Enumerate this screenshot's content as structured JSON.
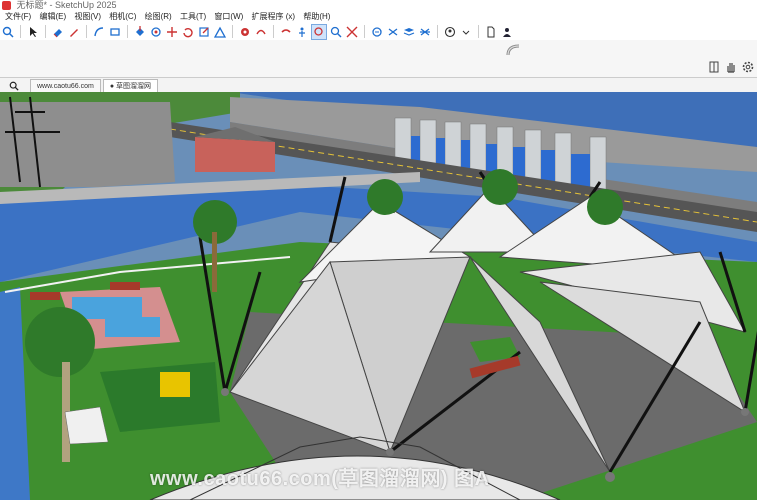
{
  "window": {
    "title": "无标题* - SketchUp 2025"
  },
  "menu": [
    "文件(F)",
    "编辑(E)",
    "视图(V)",
    "相机(C)",
    "绘图(R)",
    "工具(T)",
    "窗口(W)",
    "扩展程序 (x)",
    "帮助(H)"
  ],
  "tabs": [
    {
      "label": "www.caotu66.com"
    },
    {
      "label": "● 草图溜溜网"
    }
  ],
  "watermark": "www.caotu66.com(草图溜溜网) 图A",
  "colors": {
    "accent": "#1f6fd0",
    "water": "#3e78c7",
    "grass": "#3f8f2f"
  }
}
